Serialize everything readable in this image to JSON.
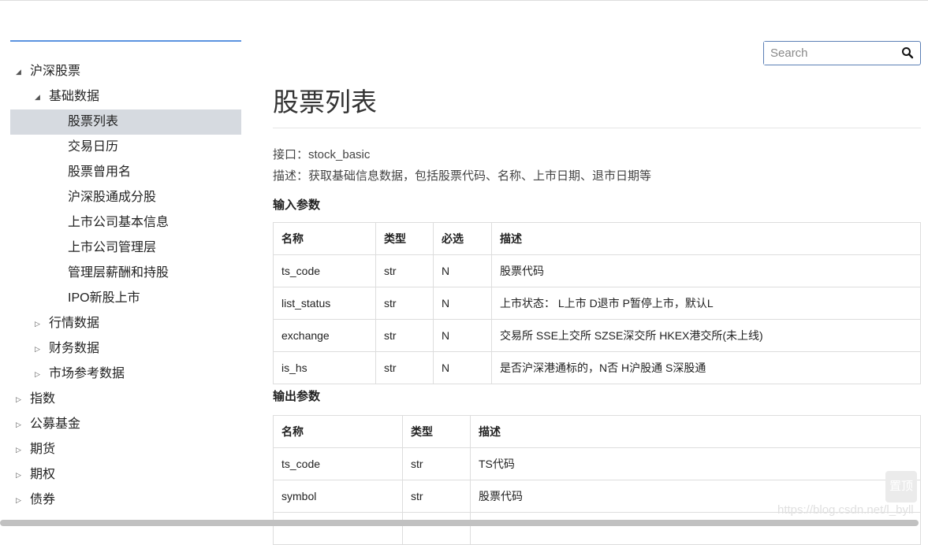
{
  "sidebar": {
    "items": [
      {
        "label": "沪深股票",
        "level": 0,
        "state": "expanded"
      },
      {
        "label": "基础数据",
        "level": 1,
        "state": "expanded"
      },
      {
        "label": "股票列表",
        "level": 2,
        "state": "leaf",
        "selected": true
      },
      {
        "label": "交易日历",
        "level": 2,
        "state": "leaf"
      },
      {
        "label": "股票曾用名",
        "level": 2,
        "state": "leaf"
      },
      {
        "label": "沪深股通成分股",
        "level": 2,
        "state": "leaf"
      },
      {
        "label": "上市公司基本信息",
        "level": 2,
        "state": "leaf"
      },
      {
        "label": "上市公司管理层",
        "level": 2,
        "state": "leaf"
      },
      {
        "label": "管理层薪酬和持股",
        "level": 2,
        "state": "leaf"
      },
      {
        "label": "IPO新股上市",
        "level": 2,
        "state": "leaf"
      },
      {
        "label": "行情数据",
        "level": 1,
        "state": "collapsed"
      },
      {
        "label": "财务数据",
        "level": 1,
        "state": "collapsed"
      },
      {
        "label": "市场参考数据",
        "level": 1,
        "state": "collapsed"
      },
      {
        "label": "指数",
        "level": 0,
        "state": "collapsed"
      },
      {
        "label": "公募基金",
        "level": 0,
        "state": "collapsed"
      },
      {
        "label": "期货",
        "level": 0,
        "state": "collapsed"
      },
      {
        "label": "期权",
        "level": 0,
        "state": "collapsed"
      },
      {
        "label": "债券",
        "level": 0,
        "state": "collapsed"
      }
    ]
  },
  "search": {
    "placeholder": "Search",
    "icon": "search-icon"
  },
  "main": {
    "title": "股票列表",
    "interface": "接口：stock_basic",
    "description": "描述：获取基础信息数据，包括股票代码、名称、上市日期、退市日期等",
    "input_heading": "输入参数",
    "input_table": {
      "headers": [
        "名称",
        "类型",
        "必选",
        "描述"
      ],
      "rows": [
        [
          "ts_code",
          "str",
          "N",
          "股票代码"
        ],
        [
          "list_status",
          "str",
          "N",
          "上市状态： L上市 D退市 P暂停上市，默认L"
        ],
        [
          "exchange",
          "str",
          "N",
          "交易所 SSE上交所 SZSE深交所 HKEX港交所(未上线)"
        ],
        [
          "is_hs",
          "str",
          "N",
          "是否沪深港通标的，N否 H沪股通 S深股通"
        ]
      ]
    },
    "output_heading": "输出参数",
    "output_table": {
      "headers": [
        "名称",
        "类型",
        "描述"
      ],
      "rows": [
        [
          "ts_code",
          "str",
          "TS代码"
        ],
        [
          "symbol",
          "str",
          "股票代码"
        ],
        [
          "",
          "",
          ""
        ]
      ]
    }
  },
  "back_to_top": "置顶",
  "watermark": "https://blog.csdn.net/l_byll",
  "colors": {
    "accent": "#5b93e0",
    "selected_bg": "#d6dae0"
  }
}
